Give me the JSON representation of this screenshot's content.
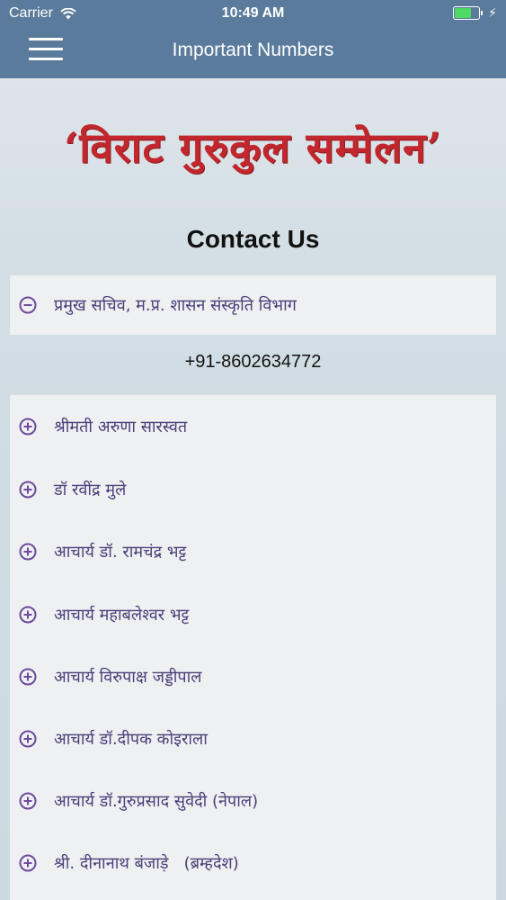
{
  "status_bar": {
    "carrier": "Carrier",
    "time": "10:49 AM",
    "battery_level": 0.7,
    "battery_color": "#4cd964"
  },
  "header": {
    "menu_icon": "hamburger-menu-icon",
    "title": "Important Numbers",
    "background": "#5a7b9c"
  },
  "banner": {
    "text": "‘विराट गुरुकुल सम्मेलन’",
    "color": "#c1272d"
  },
  "contact_section": {
    "title": "Contact Us",
    "expanded_item": {
      "name": "प्रमुख सचिव, म.प्र. शासन संस्कृति विभाग",
      "icon": "minus-circle-icon",
      "phone": "+91-8602634772"
    },
    "items": [
      {
        "name": "श्रीमती अरुणा सारस्वत",
        "icon": "plus-circle-icon"
      },
      {
        "name": "डॉ रवींद्र मुले",
        "icon": "plus-circle-icon"
      },
      {
        "name": "आचार्य डॉ. रामचंद्र भट्ट",
        "icon": "plus-circle-icon"
      },
      {
        "name": "आचार्य महाबलेश्वर भट्ट",
        "icon": "plus-circle-icon"
      },
      {
        "name": "आचार्य विरुपाक्ष जड्डीपाल",
        "icon": "plus-circle-icon"
      },
      {
        "name": "आचार्य डॉ.दीपक कोइराला",
        "icon": "plus-circle-icon"
      },
      {
        "name": "आचार्य डॉ.गुरुप्रसाद सुवेदी (नेपाल)",
        "icon": "plus-circle-icon"
      },
      {
        "name": "श्री. दीनानाथ बंजाड़े   (ब्रम्हदेश)",
        "icon": "plus-circle-icon"
      }
    ],
    "icon_color": "#6c4a9e",
    "name_color": "#4a3f7a"
  }
}
